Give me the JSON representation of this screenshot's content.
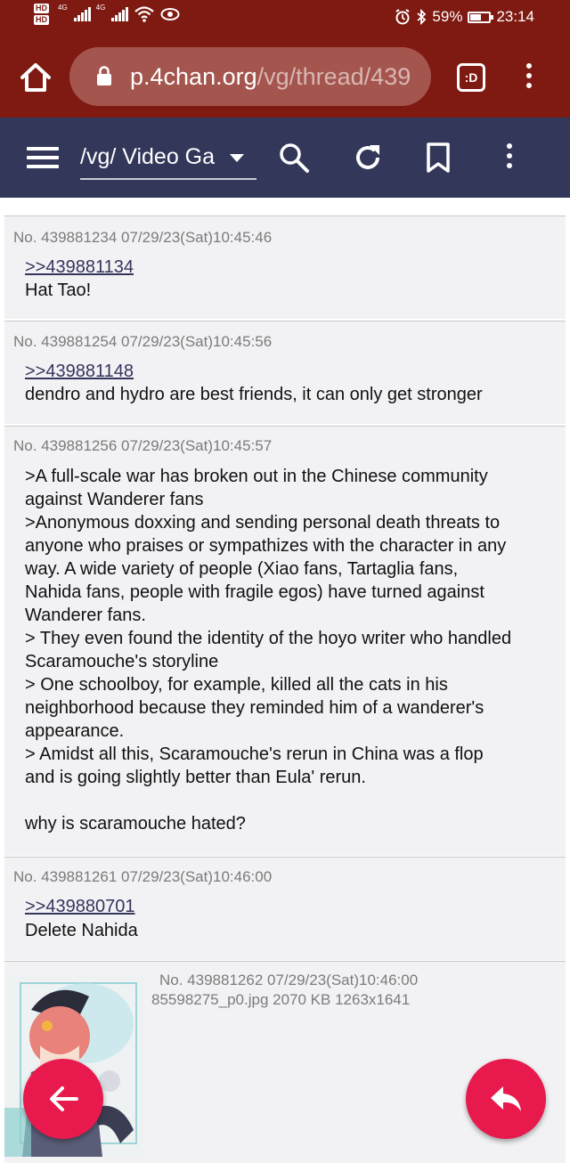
{
  "status_bar": {
    "hd1": "HD",
    "hd2": "HD",
    "signal1_label": "4G",
    "signal2_label": "4G",
    "battery_percent": "59%",
    "battery_level": 0.59,
    "time": "23:14",
    "icons": [
      "wifi-icon",
      "eye-icon",
      "alarm-icon",
      "bluetooth-icon",
      "battery-icon"
    ]
  },
  "browser": {
    "url_host": "p.4chan.org",
    "url_path": "/vg/thread/439",
    "tabs_label": ":D",
    "accent": "#7e1a12"
  },
  "app_toolbar": {
    "board_label": "/vg/ Video Ga",
    "bg_color": "#33385a",
    "icons": [
      "menu-icon",
      "search-icon",
      "refresh-icon",
      "bookmark-icon",
      "more-icon"
    ]
  },
  "posts": [
    {
      "meta": "No. 439881234 07/29/23(Sat)10:45:46",
      "quote": ">>439881134",
      "text": "Hat Tao!"
    },
    {
      "meta": "No. 439881254 07/29/23(Sat)10:45:56",
      "quote": ">>439881148",
      "text": "dendro and hydro are best friends, it can only get stronger"
    },
    {
      "meta": "No. 439881256 07/29/23(Sat)10:45:57",
      "text": ">A full-scale war has broken out in the Chinese community\nagainst Wanderer fans\n>Anonymous doxxing and sending personal death threats to\nanyone who praises or sympathizes with the character in any\nway. A wide variety of people (Xiao fans, Tartaglia fans,\nNahida fans, people with fragile egos) have turned against\nWanderer fans.\n> They even found the identity of the hoyo writer who handled\nScaramouche's storyline\n> One schoolboy, for example, killed all the cats in his\nneighborhood because they reminded him of a wanderer's\nappearance.\n> Amidst all this, Scaramouche's rerun in China was a flop\nand is going slightly better than Eula' rerun.\n\nwhy is scaramouche hated?"
    },
    {
      "meta": "No. 439881261 07/29/23(Sat)10:46:00",
      "quote": ">>439880701",
      "text": "Delete Nahida"
    },
    {
      "meta": "No. 439881262 07/29/23(Sat)10:46:00",
      "file": "85598275_p0.jpg 2070 KB 1263x1641"
    }
  ],
  "fab": {
    "back_icon": "arrow-left-icon",
    "reply_icon": "reply-icon",
    "color": "#e8194d"
  }
}
